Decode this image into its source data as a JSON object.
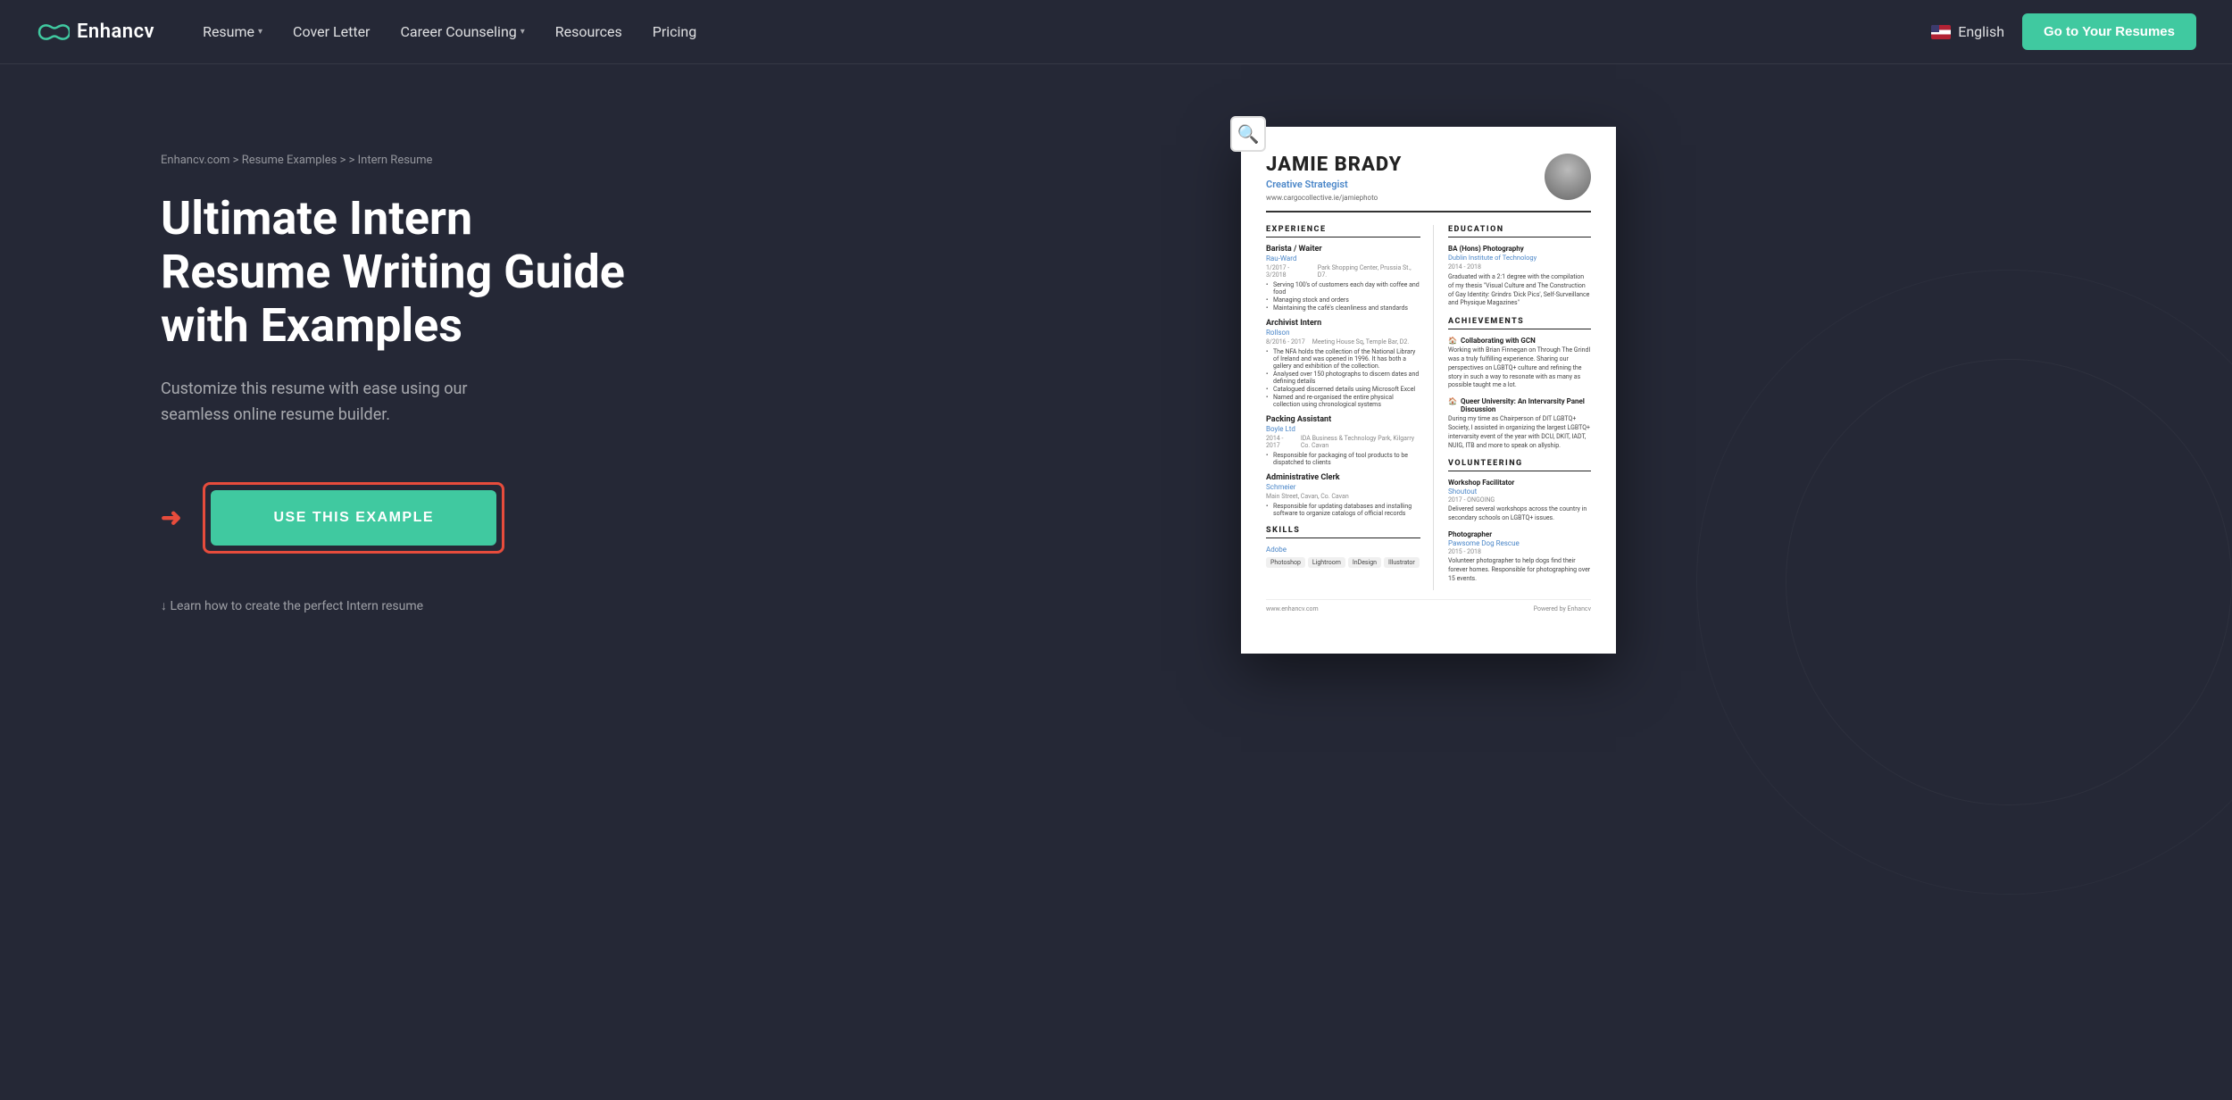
{
  "nav": {
    "logo_text": "Enhancv",
    "links": [
      {
        "label": "Resume",
        "has_dropdown": true
      },
      {
        "label": "Cover Letter",
        "has_dropdown": false
      },
      {
        "label": "Career Counseling",
        "has_dropdown": true
      },
      {
        "label": "Resources",
        "has_dropdown": false
      },
      {
        "label": "Pricing",
        "has_dropdown": false
      }
    ],
    "lang_label": "English",
    "cta_label": "Go to Your Resumes"
  },
  "breadcrumb": {
    "items": [
      "Enhancv.com",
      "Resume Examples",
      "",
      "Intern Resume"
    ]
  },
  "hero": {
    "title": "Ultimate Intern Resume Writing Guide with Examples",
    "subtitle": "Customize this resume with ease using our seamless online resume builder.",
    "cta_label": "USE THIS EXAMPLE",
    "learn_more": "Learn how to create the perfect Intern resume"
  },
  "resume": {
    "name": "JAMIE BRADY",
    "title": "Creative Strategist",
    "website": "www.cargocollective.ie/jamiephoto",
    "sections": {
      "experience": {
        "title": "EXPERIENCE",
        "jobs": [
          {
            "title": "Barista / Waiter",
            "company": "Rau-Ward",
            "dates": "1/2017 - 3/2018",
            "location": "Park Shopping Center, Prussia St., D7.",
            "bullets": [
              "Serving 100's of customers each day with coffee and food",
              "Managing stock and orders",
              "Maintaining the café's cleanliness and standards"
            ]
          },
          {
            "title": "Archivist Intern",
            "company": "Rollson",
            "dates": "8/2016 - 2017",
            "location": "Meeting House Sq, Temple Bar, D2.",
            "bullets": [
              "The NFA holds the collection of the National Library of Ireland and was opened in 1996. It has both a gallery and exhibition of the collection.",
              "Analysed over 150 photographs to discern dates and defining details",
              "Catalogued discerned details using Microsoft Excel",
              "Named and re-organised the entire physical collection using chronological systems"
            ]
          },
          {
            "title": "Packing Assistant",
            "company": "Boyle Ltd",
            "dates": "2014 - 2017",
            "location": "IDA Business & Technology Park, Kilgarry Co. Cavan",
            "bullets": [
              "Responsible for packaging of tool products to be dispatched to clients"
            ]
          },
          {
            "title": "Administrative Clerk",
            "company": "Schmeier",
            "dates": "",
            "location": "Main Street, Cavan, Co. Cavan",
            "bullets": [
              "Responsible for updating databases and installing software to organize catalogs of official records"
            ]
          }
        ]
      },
      "skills": {
        "title": "SKILLS",
        "category": "Adobe",
        "tags": [
          "Photoshop",
          "Lightroom",
          "InDesign",
          "Illustrator"
        ]
      },
      "education": {
        "title": "EDUCATION",
        "degree": "BA (Hons) Photography",
        "school": "Dublin Institute of Technology",
        "dates": "2014 - 2018",
        "description": "Graduated with a 2:1 degree with the compilation of my thesis \"Visual Culture and The Construction of Gay Identity: Grindrs 'Dick Pics', Self-Surveillance and Physique Magazines\""
      },
      "achievements": {
        "title": "ACHIEVEMENTS",
        "items": [
          {
            "title": "Collaborating with GCN",
            "description": "Working with Brian Finnegan on Through The Grindl was a truly fulfilling experience. Sharing our perspectives on LGBTQ+ culture and refining the story in such a way to resonate with as many as possible taught me a lot."
          },
          {
            "title": "Queer University: An Intervarsity Panel Discussion",
            "description": "During my time as Chairperson of DIT LGBTQ+ Society, I assisted in organizing the largest LGBTQ+ intervarsity event of the year with DCU, DKIT, IADT, NUIG, ITB and more to speak on allyship."
          }
        ]
      },
      "volunteering": {
        "title": "VOLUNTEERING",
        "items": [
          {
            "title": "Workshop Facilitator",
            "org": "Shoutout",
            "dates": "2017 - ONGOING",
            "description": "Delivered several workshops across the country in secondary schools on LGBTQ+ issues."
          },
          {
            "title": "Photographer",
            "org": "Pawsome Dog Rescue",
            "dates": "2015 - 2018",
            "description": "Volunteer photographer to help dogs find their forever homes. Responsible for photographing over 15 events."
          }
        ]
      }
    },
    "footer": {
      "url": "www.enhancv.com",
      "brand": "Powered by Enhancv"
    }
  }
}
